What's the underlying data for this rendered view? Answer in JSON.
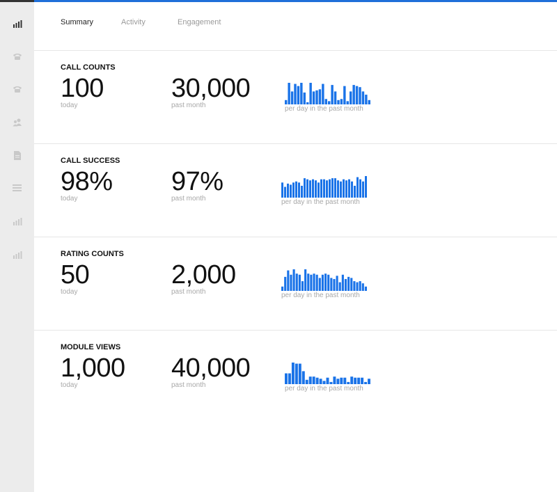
{
  "colors": {
    "accent": "#1f6fd9",
    "bar": "#1a73e8",
    "sidebar_bg": "#ececec",
    "muted_text": "#a8a8a8"
  },
  "sidebar": {
    "items": [
      {
        "icon": "bar-chart-icon",
        "active": true
      },
      {
        "icon": "phone-icon",
        "active": false
      },
      {
        "icon": "phone-icon",
        "active": false
      },
      {
        "icon": "users-icon",
        "active": false
      },
      {
        "icon": "document-icon",
        "active": false
      },
      {
        "icon": "list-icon",
        "active": false
      },
      {
        "icon": "bar-chart-icon",
        "active": false
      },
      {
        "icon": "bar-chart-icon",
        "active": false
      }
    ]
  },
  "tabs": [
    {
      "label": "Summary",
      "active": true
    },
    {
      "label": "Activity",
      "active": false
    },
    {
      "label": "Engagement",
      "active": false
    }
  ],
  "sections": [
    {
      "title": "CALL COUNTS",
      "today_value": "100",
      "today_label": "today",
      "month_value": "30,000",
      "month_label": "past month",
      "spark_label": "per day in the past month",
      "spark_values": [
        0.2,
        1.0,
        0.6,
        0.95,
        0.85,
        1.0,
        0.55,
        0.1,
        1.0,
        0.6,
        0.65,
        0.7,
        0.95,
        0.25,
        0.15,
        0.9,
        0.6,
        0.2,
        0.25,
        0.85,
        0.15,
        0.6,
        0.9,
        0.85,
        0.8,
        0.6,
        0.45,
        0.2
      ]
    },
    {
      "title": "CALL SUCCESS",
      "today_value": "98%",
      "today_label": "today",
      "month_value": "97%",
      "month_label": "past month",
      "spark_label": "per day in the past month",
      "spark_values": [
        0.7,
        0.5,
        0.65,
        0.6,
        0.7,
        0.75,
        0.7,
        0.55,
        0.9,
        0.85,
        0.8,
        0.85,
        0.8,
        0.7,
        0.85,
        0.85,
        0.8,
        0.85,
        0.9,
        0.9,
        0.8,
        0.75,
        0.85,
        0.8,
        0.85,
        0.75,
        0.55,
        0.95,
        0.85,
        0.75,
        1.0
      ]
    },
    {
      "title": "RATING COUNTS",
      "today_value": "50",
      "today_label": "today",
      "month_value": "2,000",
      "month_label": "past month",
      "spark_label": "per day in the past month",
      "spark_values": [
        0.2,
        0.65,
        0.95,
        0.75,
        1.0,
        0.8,
        0.75,
        0.45,
        1.0,
        0.8,
        0.75,
        0.8,
        0.75,
        0.6,
        0.75,
        0.8,
        0.75,
        0.6,
        0.55,
        0.7,
        0.4,
        0.75,
        0.55,
        0.65,
        0.6,
        0.45,
        0.4,
        0.45,
        0.35,
        0.2
      ]
    },
    {
      "title": "MODULE VIEWS",
      "today_value": "1,000",
      "today_label": "today",
      "month_value": "40,000",
      "month_label": "past month",
      "spark_label": "per day in the past month",
      "spark_values": [
        0.5,
        0.5,
        1.0,
        0.95,
        0.95,
        0.6,
        0.2,
        0.35,
        0.35,
        0.3,
        0.25,
        0.15,
        0.3,
        0.1,
        0.35,
        0.25,
        0.3,
        0.3,
        0.1,
        0.35,
        0.3,
        0.3,
        0.3,
        0.1,
        0.25
      ]
    }
  ]
}
